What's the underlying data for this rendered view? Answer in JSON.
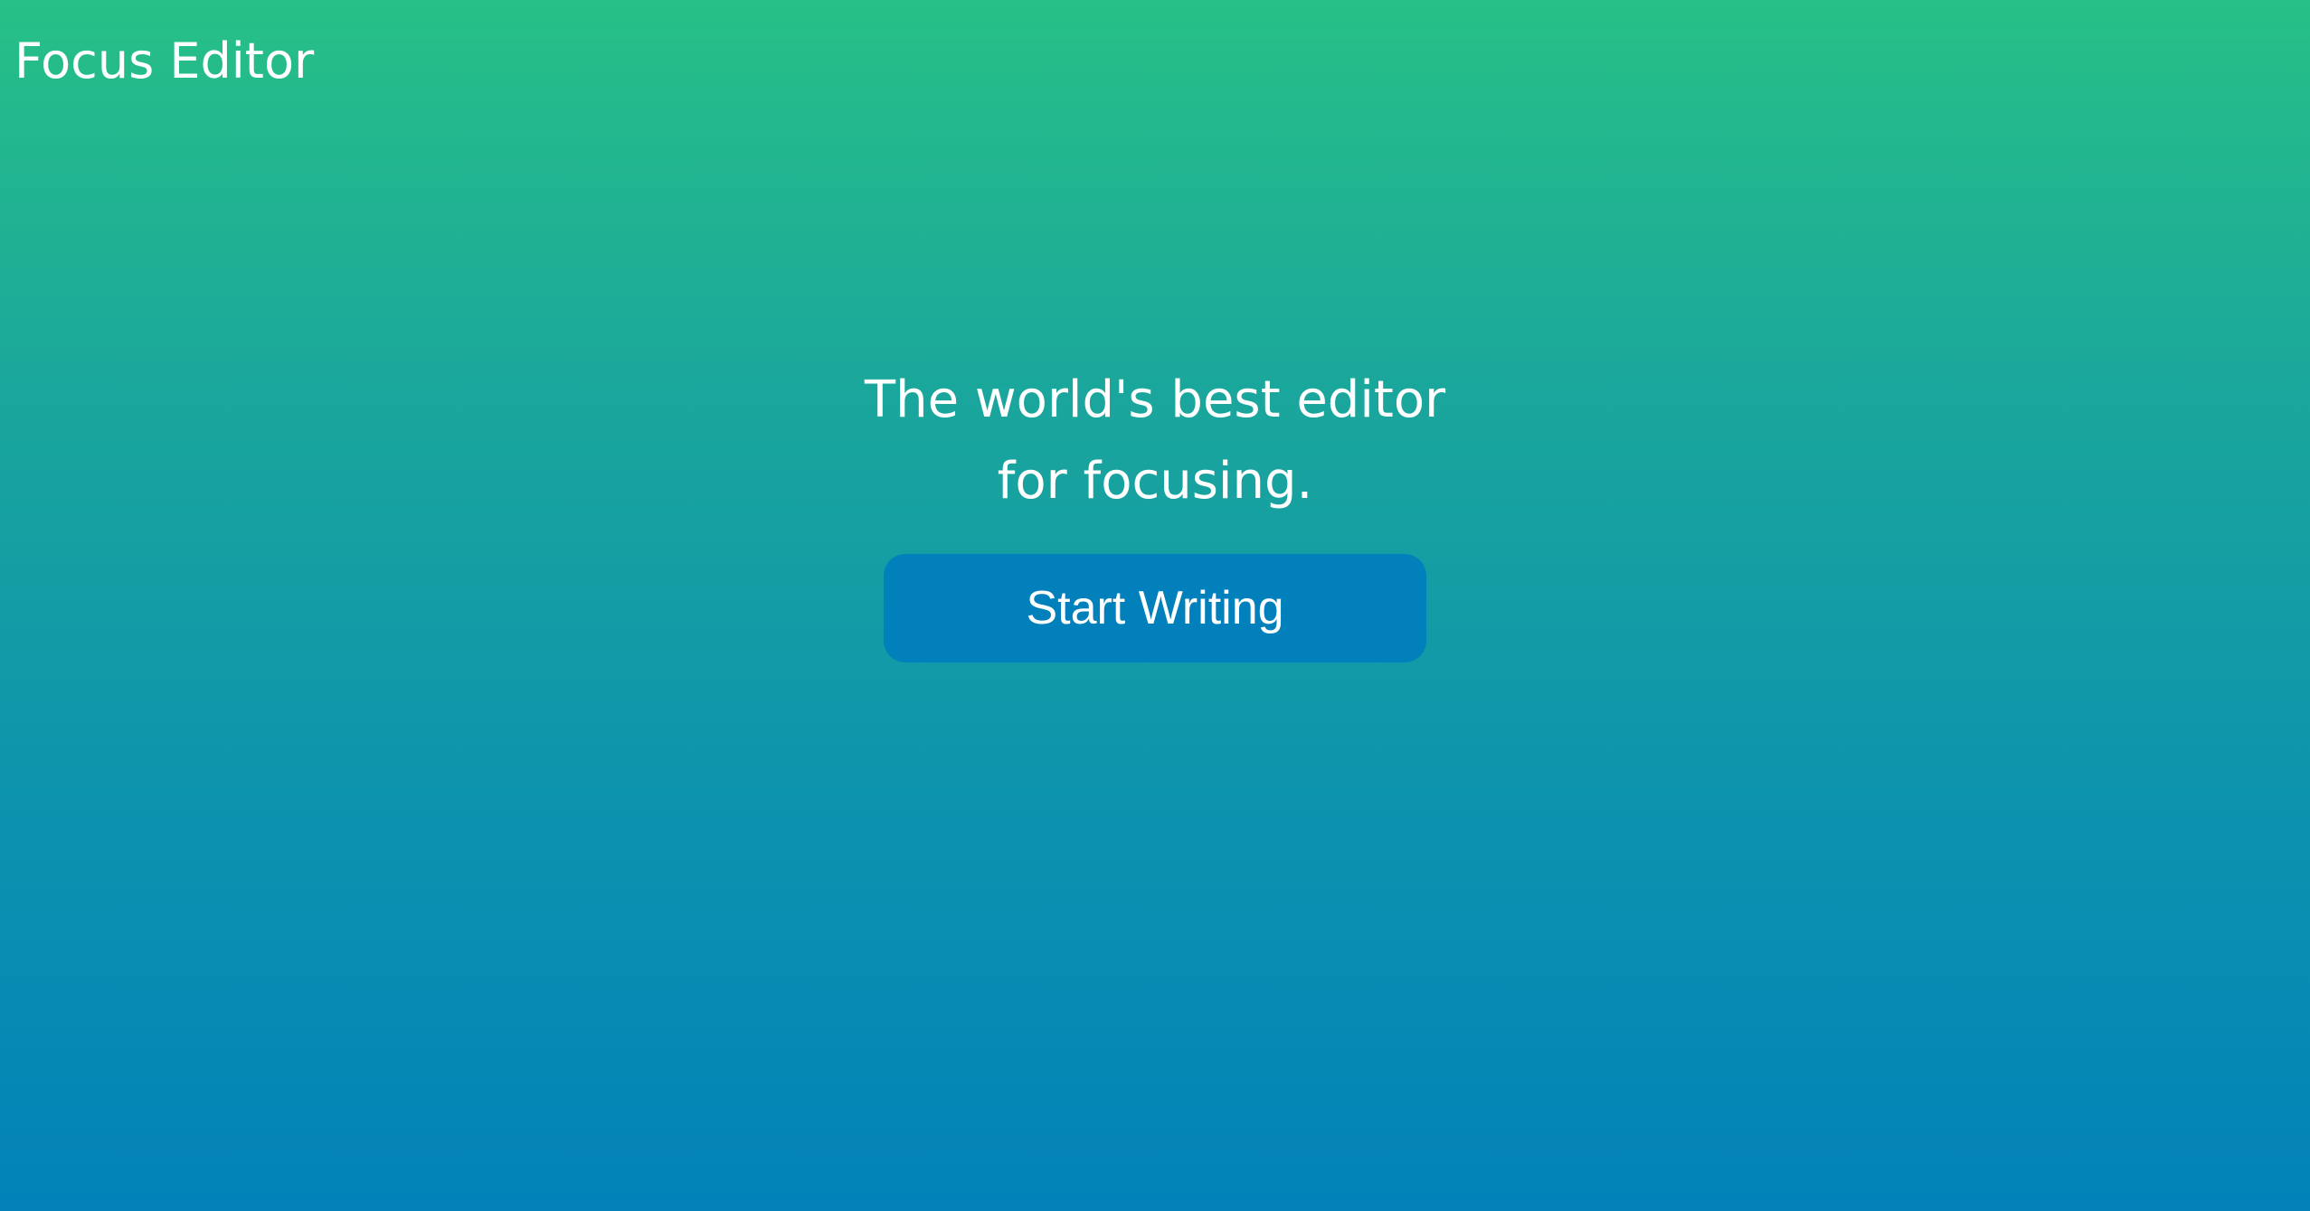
{
  "header": {
    "app_title": "Focus Editor"
  },
  "hero": {
    "tagline_line1": "The world's best editor",
    "tagline_line2": "for focusing.",
    "cta_label": "Start Writing"
  },
  "colors": {
    "gradient_top": "#27c087",
    "gradient_bottom": "#0282b8",
    "button_bg": "#0180bb",
    "text": "#ffffff"
  }
}
